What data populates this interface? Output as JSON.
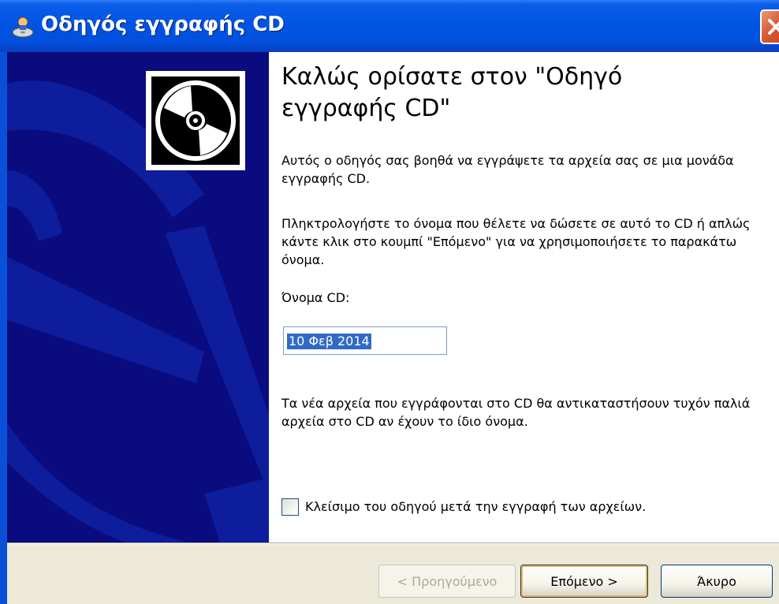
{
  "window": {
    "title": "Οδηγός εγγραφής CD"
  },
  "colors": {
    "titlebar": "#0054e3",
    "side_panel": "#0a0b7e",
    "selection": "#316ac5",
    "default_button_focus": "#f8b34a"
  },
  "icons": {
    "title": "cd-burn-icon",
    "logo": "cd-disc-icon",
    "close": "close-icon"
  },
  "content": {
    "heading": "Καλώς ορίσατε στον \"Οδηγό εγγραφής CD\"",
    "intro": "Αυτός ο οδηγός σας βοηθά να εγγράψετε τα αρχεία σας σε μια μονάδα εγγραφής CD.",
    "instruction": "Πληκτρολογήστε το όνομα που θέλετε να δώσετε σε αυτό το CD ή απλώς κάντε κλικ στο κουμπί \"Επόμενο\" για να χρησιμοποιήσετε το παρακάτω όνομα.",
    "name_label": "Όνομα CD:",
    "name_value": "10 Φεβ 2014",
    "overwrite_note": "Τα νέα αρχεία που εγγράφονται στο CD θα αντικαταστήσουν τυχόν παλιά αρχεία στο CD αν έχουν το ίδιο όνομα.",
    "close_checkbox_label": "Κλείσιμο του οδηγού μετά την εγγραφή των αρχείων.",
    "close_checkbox_checked": false
  },
  "buttons": {
    "back": "< Προηγούμενο",
    "next": "Επόμενο >",
    "cancel": "Άκυρο"
  }
}
